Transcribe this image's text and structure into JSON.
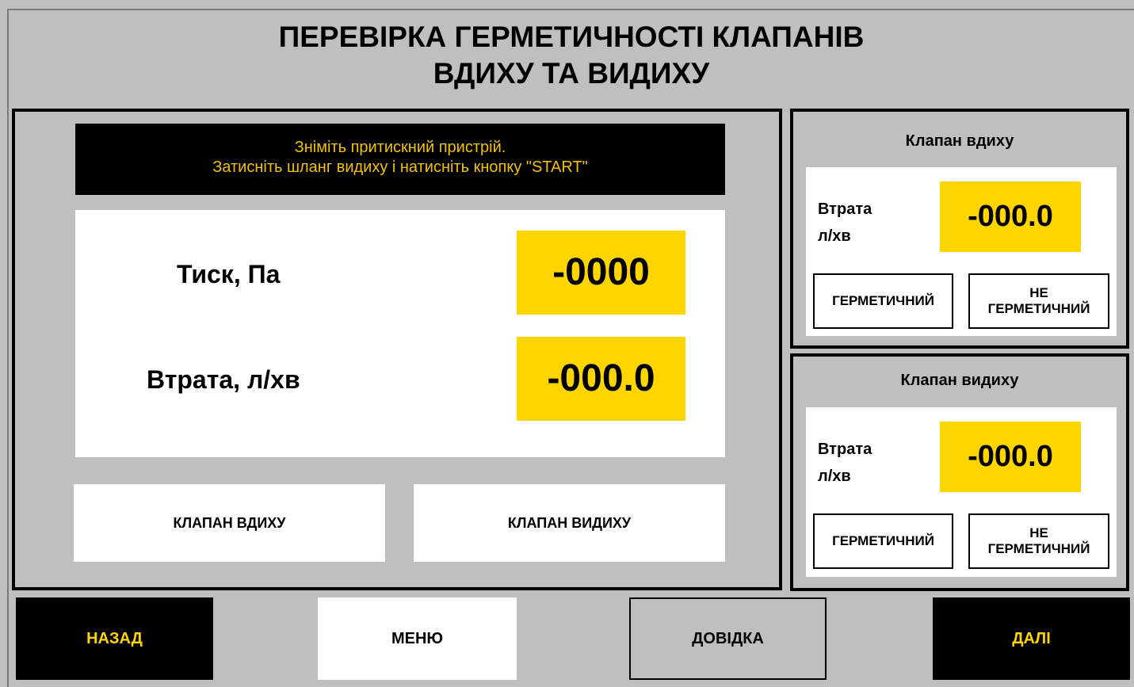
{
  "header": {
    "title_line1": "ПЕРЕВІРКА ГЕРМЕТИЧНОСТІ КЛАПАНІВ",
    "title_line2": "ВДИХУ ТА ВИДИХУ"
  },
  "main": {
    "message_line1": "Зніміть притискний пристрій.",
    "message_line2": "Затисніть шланг видиху і натисніть кнопку \"START\"",
    "pressure_label": "Тиск, Па",
    "pressure_value": "-0000",
    "loss_label": "Втрата, л/хв",
    "loss_value": "-000.0",
    "inhale_valve_button": "КЛАПАН ВДИХУ",
    "exhale_valve_button": "КЛАПАН ВИДИХУ"
  },
  "inhale_valve": {
    "title": "Клапан вдиху",
    "loss_label_line1": "Втрата",
    "loss_label_line2": "л/хв",
    "loss_value": "-000.0",
    "sealed_button": "ГЕРМЕТИЧНИЙ",
    "not_sealed_line1": "НЕ",
    "not_sealed_line2": "ГЕРМЕТИЧНИЙ"
  },
  "exhale_valve": {
    "title": "Клапан видиху",
    "loss_label_line1": "Втрата",
    "loss_label_line2": "л/хв",
    "loss_value": "-000.0",
    "sealed_button": "ГЕРМЕТИЧНИЙ",
    "not_sealed_line1": "НЕ",
    "not_sealed_line2": "ГЕРМЕТИЧНИЙ"
  },
  "footer": {
    "back_label": "НАЗАД",
    "menu_label": "МЕНЮ",
    "help_label": "ДОВІДКА",
    "next_label": "ДАЛІ"
  },
  "colors": {
    "background": "#bfbfbf",
    "value_highlight": "#ffd500",
    "message_text": "#f2c200",
    "nav_text": "#ffd500",
    "dark": "#000000"
  }
}
